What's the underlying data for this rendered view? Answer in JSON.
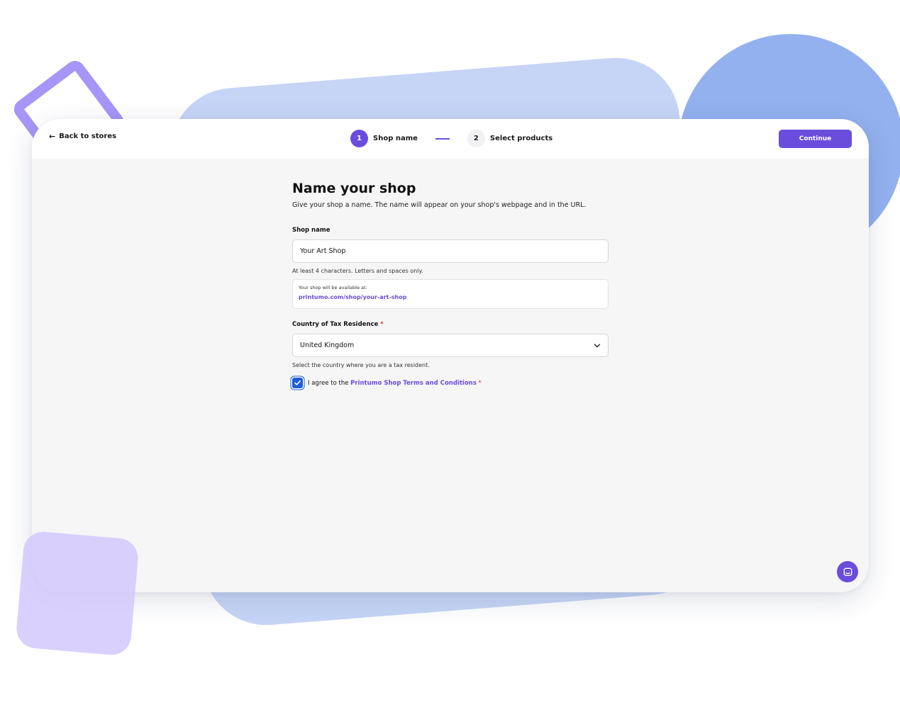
{
  "header": {
    "back_label": "Back to stores",
    "steps": [
      {
        "number": "1",
        "label": "Shop name",
        "state": "active"
      },
      {
        "number": "2",
        "label": "Select products",
        "state": "inactive"
      }
    ],
    "continue_label": "Continue"
  },
  "form": {
    "title": "Name your shop",
    "subtitle": "Give your shop a name. The name will appear on your shop's webpage and in the URL.",
    "shop_name": {
      "label": "Shop name",
      "value": "Your Art Shop",
      "hint": "At least 4 characters. Letters and spaces only."
    },
    "url_preview": {
      "caption": "Your shop will be available at:",
      "url": "printumo.com/shop/your-art-shop"
    },
    "country": {
      "label": "Country of Tax Residence",
      "required_mark": "*",
      "selected": "United Kingdom",
      "hint": "Select the country where you are a tax resident."
    },
    "agree": {
      "checked": true,
      "prefix": "I agree to the",
      "link_text": "Printumo Shop Terms and Conditions",
      "required_mark": "*"
    }
  },
  "icons": {
    "back": "arrow-left-icon",
    "select": "chevron-down-icon",
    "check": "checkmark-icon",
    "chat": "chat-icon"
  },
  "colors": {
    "accent": "#6a4ddc",
    "required": "#e2312d",
    "checkbox": "#1d5fd8",
    "window_background": "#f6f6f6",
    "header_background": "#ffffff"
  }
}
